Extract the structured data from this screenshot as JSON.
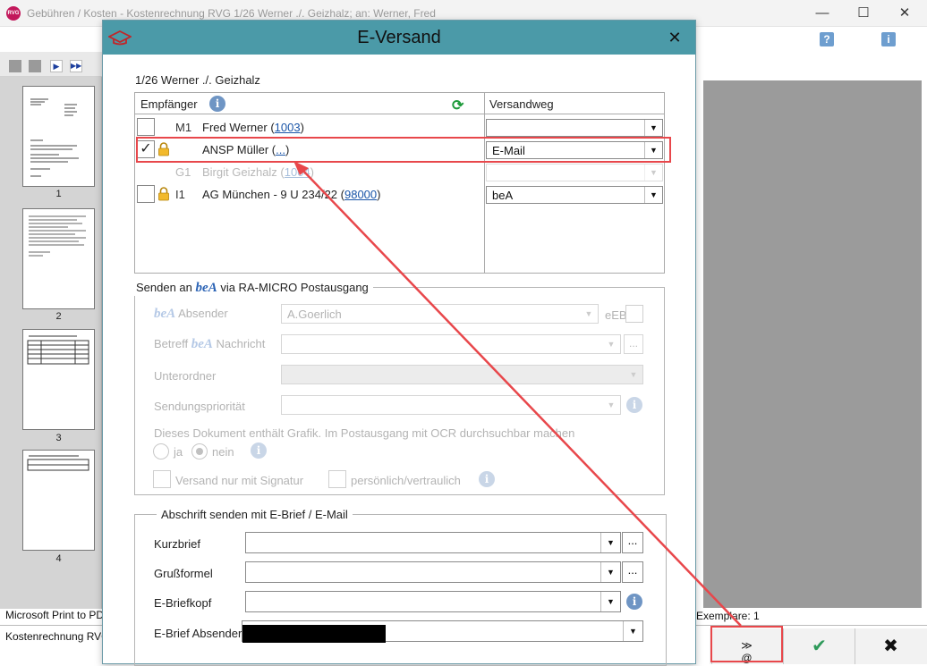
{
  "window": {
    "title": "Gebühren / Kosten - Kostenrechnung RVG 1/26 Werner ./. Geizhalz; an: Werner, Fred",
    "logo_text": "RVG"
  },
  "thumbnails": [
    "1",
    "2",
    "3",
    "4"
  ],
  "printer": "Microsoft Print to PDF",
  "document_name": "Kostenrechnung RVG",
  "exemplare": "Exemplare: 1",
  "dialog": {
    "title": "E-Versand",
    "case": "1/26    Werner ./. Geizhalz",
    "recipients_header": "Empfänger",
    "versandweg_header": "Versandweg",
    "recipients": [
      {
        "code": "M1",
        "name": "Fred Werner (",
        "link": "1003",
        "suffix": ")",
        "checked": false,
        "locked": false,
        "enabled": true,
        "versandweg": ""
      },
      {
        "code": "",
        "name": "ANSP Müller (",
        "link": "...",
        "suffix": ")",
        "checked": true,
        "locked": true,
        "enabled": true,
        "versandweg": "E-Mail"
      },
      {
        "code": "G1",
        "name": "Birgit Geizhalz (",
        "link": "1004",
        "suffix": ")",
        "checked": false,
        "locked": false,
        "enabled": false,
        "versandweg": ""
      },
      {
        "code": "I1",
        "name": "AG München  - 9 U 234/22 (",
        "link": "98000",
        "suffix": ")",
        "checked": false,
        "locked": true,
        "enabled": true,
        "versandweg": "beA"
      }
    ],
    "bea_group": {
      "title_prefix": "Senden an",
      "bea": "beA",
      "title_suffix": "via RA-MICRO Postausgang",
      "absender_label": "Absender",
      "absender_value": "A.Goerlich",
      "eeb_label": "eEB",
      "betreff_label": "Betreff",
      "nachricht_label": "Nachricht",
      "unterordner_label": "Unterordner",
      "prioritaet_label": "Sendungspriorität",
      "ocr_text": "Dieses Dokument enthält Grafik. Im Postausgang mit OCR durchsuchbar machen",
      "ja_label": "ja",
      "nein_label": "nein",
      "signatur_label": "Versand nur mit Signatur",
      "vertraulich_label": "persönlich/vertraulich",
      "ellipsis": "..."
    },
    "abschrift_group": {
      "title": "Abschrift senden mit E-Brief / E-Mail",
      "kurzbrief_label": "Kurzbrief",
      "grussformel_label": "Grußformel",
      "briefkopf_label": "E-Briefkopf",
      "absender_label": "E-Brief Absender",
      "ellipsis": "..."
    }
  },
  "colors": {
    "dialog_titlebar": "#4b9aa8",
    "highlight": "#e8474b",
    "ok": "#2e9a5a",
    "link": "#1a55a8"
  },
  "icons": {
    "cap": "graduation-cap-icon",
    "refresh": "refresh-icon",
    "info": "info-icon",
    "lock": "lock-icon",
    "send": "email-send-icon",
    "ok": "checkmark-icon",
    "cancel": "close-icon"
  }
}
